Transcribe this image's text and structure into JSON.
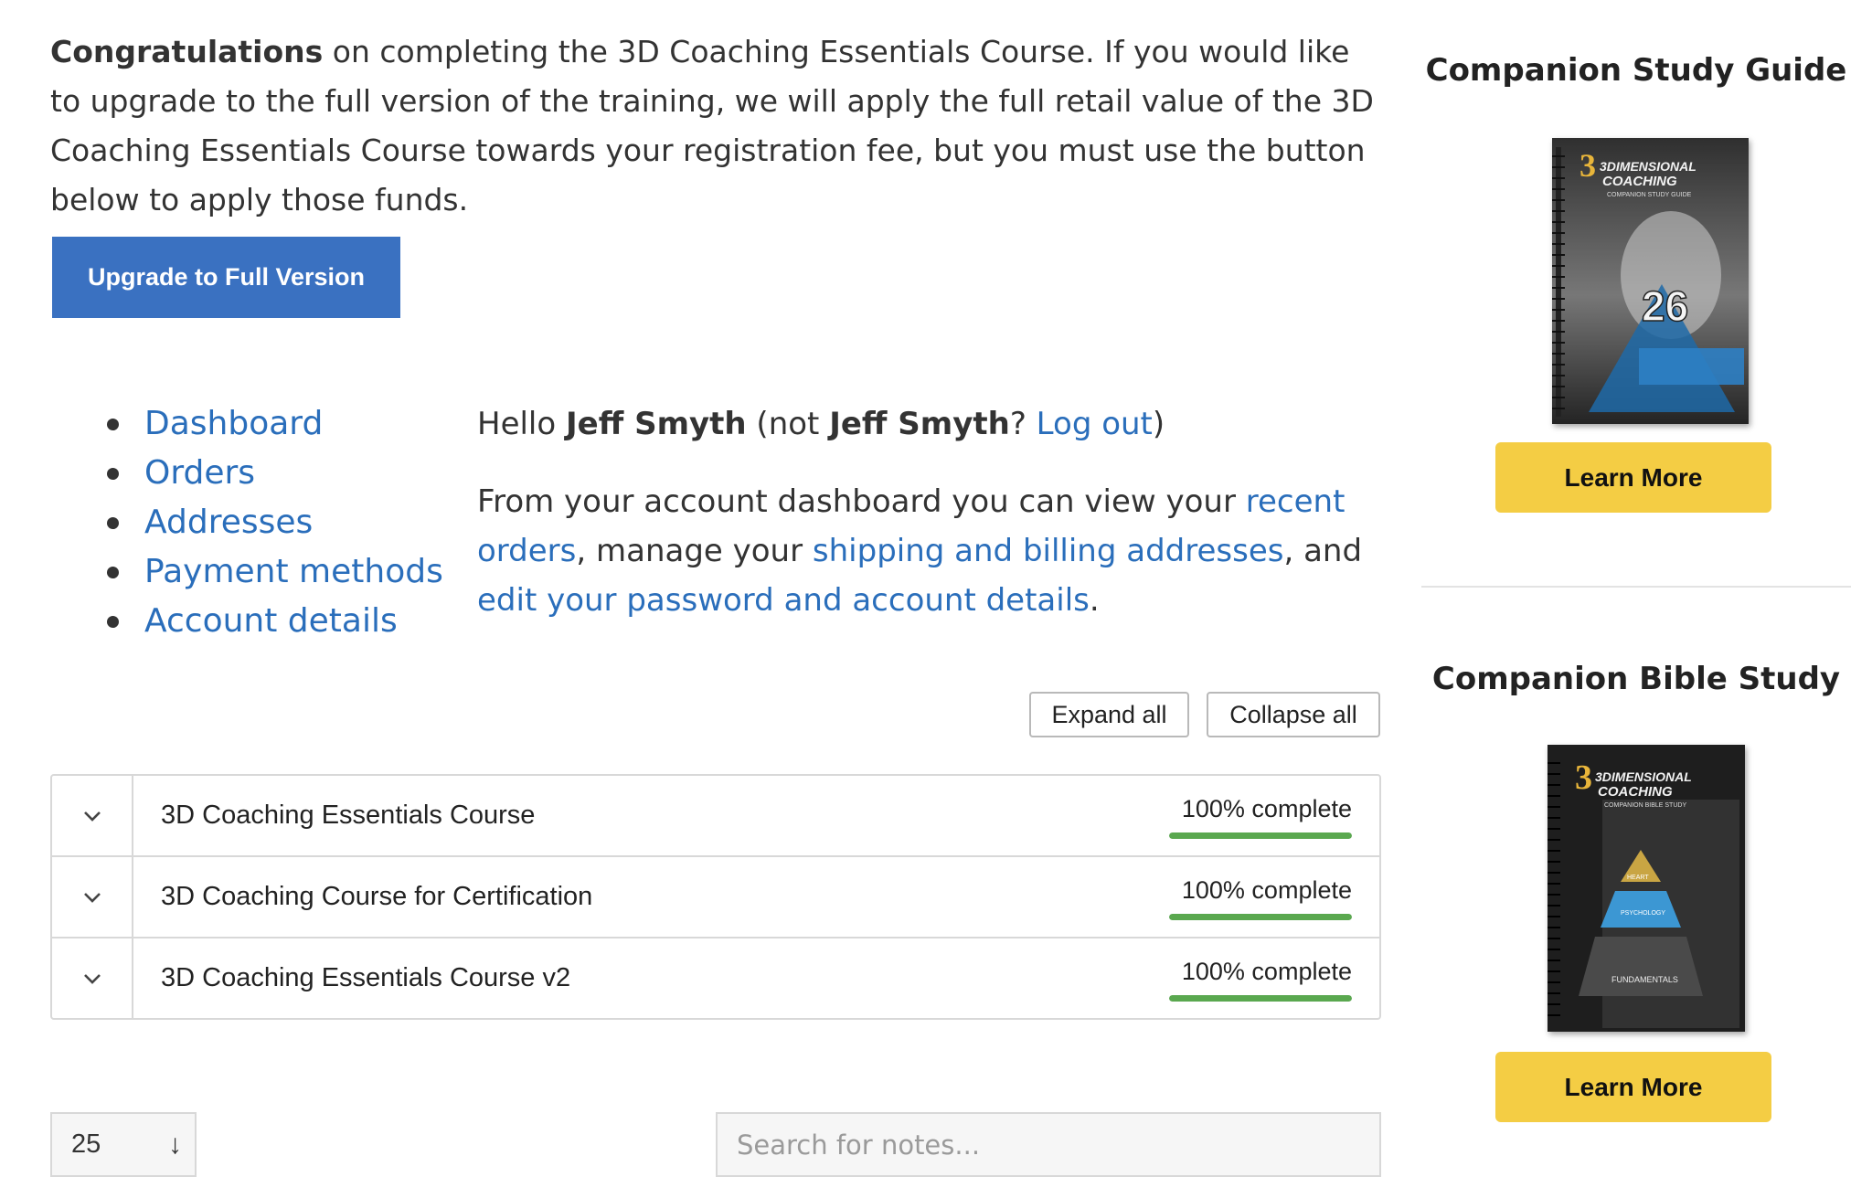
{
  "notice": {
    "bold_lead": "Congratulations",
    "text": " on completing the 3D Coaching Essentials Course. If you would like to upgrade to the full version of the training, we will apply the full retail value of the 3D Coaching Essentials Course towards your registration fee, but you must use the button below to apply those funds.",
    "button_label": "Upgrade to Full Version"
  },
  "account_nav": {
    "items": [
      "Dashboard",
      "Orders",
      "Addresses",
      "Payment methods",
      "Account details"
    ]
  },
  "account": {
    "hello_prefix": "Hello ",
    "user_name": "Jeff Smyth",
    "hello_not": " (not ",
    "user_name_2": "Jeff Smyth",
    "hello_q": "? ",
    "logout_label": "Log out",
    "hello_close": ")",
    "intro_1": "From your account dashboard you can view your ",
    "link_recent_orders": "recent orders",
    "intro_2": ", manage your ",
    "link_addresses": "shipping and billing addresses",
    "intro_3": ", and ",
    "link_account_details": "edit your password and account details",
    "intro_4": "."
  },
  "courses": {
    "expand_all": "Expand all",
    "collapse_all": "Collapse all",
    "rows": [
      {
        "title": "3D Coaching Essentials Course",
        "progress_text": "100% complete",
        "progress": 1.0
      },
      {
        "title": "3D Coaching Course for Certification",
        "progress_text": "100% complete",
        "progress": 1.0
      },
      {
        "title": "3D Coaching Essentials Course v2",
        "progress_text": "100% complete",
        "progress": 1.0
      }
    ]
  },
  "notes": {
    "per_page": "25",
    "per_page_arrow": "↓",
    "search_placeholder": "Search for notes..."
  },
  "sidebar": {
    "widget_1": {
      "title": "Companion Study Guide",
      "button": "Learn More",
      "cover_brand_1": "3DIMENSIONAL",
      "cover_brand_2": "COACHING",
      "cover_sub": "COMPANION STUDY GUIDE",
      "cover_number": "26"
    },
    "widget_2": {
      "title": "Companion Bible Study",
      "button": "Learn More",
      "cover_brand_1": "3DIMENSIONAL",
      "cover_brand_2": "COACHING",
      "cover_sub": "COMPANION BIBLE STUDY",
      "tier_1": "HEART",
      "tier_2": "PSYCHOLOGY",
      "tier_3": "FUNDAMENTALS"
    }
  },
  "colors": {
    "link": "#2a6ebb",
    "primary_button": "#3a71c1",
    "learn_more": "#f4cd44",
    "progress": "#5aa84f"
  }
}
